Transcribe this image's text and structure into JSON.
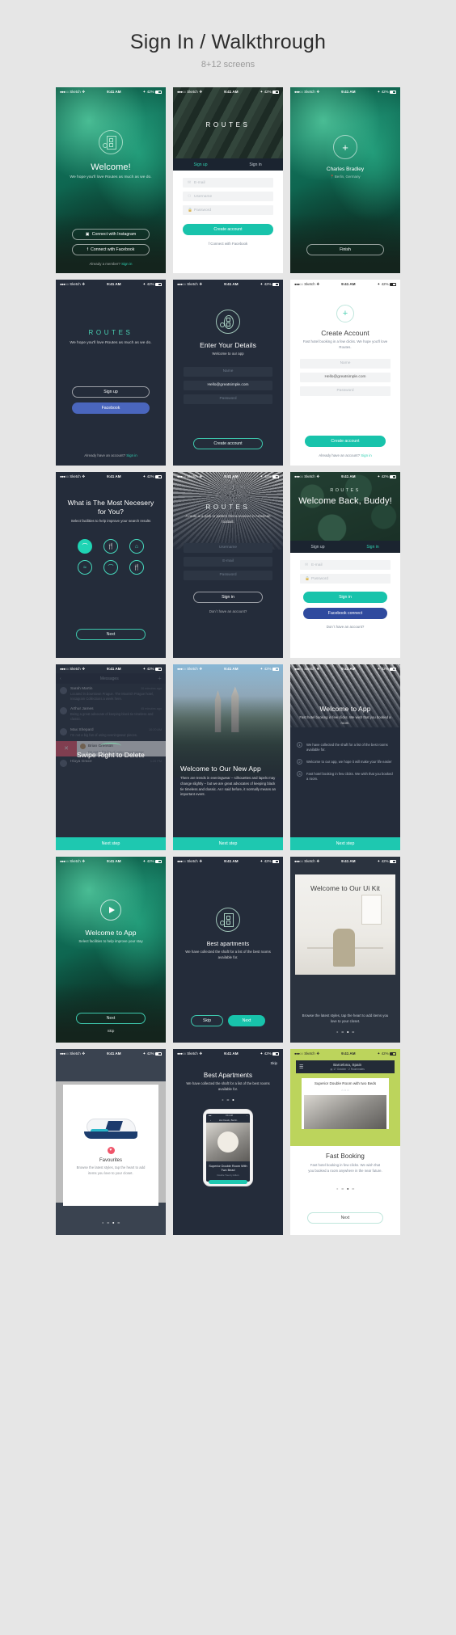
{
  "page": {
    "title": "Sign In / Walkthrough",
    "subtitle": "8+12 screens"
  },
  "status": {
    "carrier": "Sketch",
    "time": "9:41 AM",
    "battery": "42%"
  },
  "colors": {
    "teal": "#18c3ab",
    "facebook": "#4a66bd",
    "accent_link": "#2fd0b2",
    "red": "#f0556a",
    "lime": "#bcd45c"
  },
  "brand": "ROUTES",
  "screens": [
    {
      "id": "welcome-aurora",
      "title": "Welcome!",
      "desc": "We hope you'll love Routes as much as we do.",
      "btn_instagram": "Connect with Instagram",
      "btn_facebook": "Connect with Facebook",
      "footer": "Already a member?",
      "footer_link": "Sign in"
    },
    {
      "id": "routes-signup-form",
      "brand": "ROUTES",
      "tab_signup": "Sign up",
      "tab_signin": "Sign in",
      "field_email": "E-mail",
      "field_username": "Username",
      "field_password": "Password",
      "btn_create": "Create account",
      "footer_fb": "Connect with Facebook"
    },
    {
      "id": "profile-finish",
      "name": "Charles Bradley",
      "location": "Berlin, Germany",
      "btn_finish": "Finish"
    },
    {
      "id": "routes-dark-signup",
      "brand": "ROUTES",
      "desc": "We hope you'll love Routes as much as we do.",
      "btn_signup": "Sign up",
      "btn_facebook": "Facebook",
      "footer": "Already have an account?",
      "footer_link": "Sign in"
    },
    {
      "id": "enter-your-details",
      "title": "Enter Your Details",
      "desc": "Welcome to our app",
      "field_name": "Name",
      "field_email": "Hello@greatsimple.com",
      "field_password": "Password",
      "btn_create": "Create account"
    },
    {
      "id": "create-account-white",
      "title": "Create Account",
      "desc": "Fast hotel booking in a few clicks. We hope you'll love Routes.",
      "field_name": "Name",
      "field_email": "Hello@greatsimple.com",
      "field_password": "Password",
      "btn_create": "Create account",
      "footer": "Already have an account?",
      "footer_link": "Sign in"
    },
    {
      "id": "facilities",
      "title": "What is The Most Necesery for You?",
      "desc": "Select facilities to help improve your search results",
      "btn_next": "Next",
      "icons": [
        "wifi",
        "restaurant",
        "room-service",
        "spa",
        "wifi",
        "restaurant"
      ]
    },
    {
      "id": "routes-signin-dark",
      "brand": "ROUTES",
      "desc": "A route is a path or pattern that a receiver in American football.",
      "field_username": "Username",
      "field_email": "E-mail",
      "field_password": "Password",
      "btn_signin": "Sign in",
      "footer": "Don`t have an account?"
    },
    {
      "id": "welcome-back",
      "brand": "ROUTES",
      "title": "Welcome Back, Buddy!",
      "tab_signup": "Sign up",
      "tab_signin": "Sign in",
      "field_email": "E-mail",
      "field_password": "Password",
      "btn_signin": "Sign in",
      "btn_facebook": "Facebook connect",
      "footer": "Don`t have an account?"
    },
    {
      "id": "swipe-to-delete",
      "nav_title": "Messages",
      "overlay_title": "Swipe Right to Delete",
      "btn_next_step": "Next step",
      "messages": [
        {
          "name": "Sarah Martin",
          "time": "10 minutes ago",
          "text": "Located in downtown Prague. The Moorish Prague hotel, Instagram Collections a week here."
        },
        {
          "name": "Arthur James",
          "time": "45 minutes ago",
          "text": "Being a great advocate of keeping black tie timeless and classic."
        },
        {
          "name": "Max Shepard",
          "time": "10:20 AM",
          "text": "I'm not a big fan of using eveningwear pieces."
        },
        {
          "name": "Brian Grenson",
          "time": "",
          "text": "I'm not a big fan of using eveningwear"
        },
        {
          "name": "Hiuya Grace",
          "time": "1:20 PM",
          "text": ""
        }
      ]
    },
    {
      "id": "welcome-new-app",
      "title": "Welcome to Our New App",
      "desc": "There are trends in eveningwear – silhouettes and lapels may change slightly – but we are great advocates of keeping black tie timeless and classic. As I said before, it normally means an important event.",
      "btn_next_step": "Next step"
    },
    {
      "id": "welcome-to-app-list",
      "title": "Welcome to App",
      "desc": "Fast hotel booking in few clicks. We wish that you booked a room.",
      "items": [
        {
          "n": "1",
          "text": "We have collected the shaft for a list of the best rooms available for."
        },
        {
          "n": "2",
          "text": "Welcome to our app, we hope it will make your life easier"
        },
        {
          "n": "3",
          "text": "Fast hotel booking in few clicks. We wish that you booked a room."
        }
      ],
      "btn_next_step": "Next step"
    },
    {
      "id": "welcome-to-app-video",
      "title": "Welcome to App",
      "desc": "Select facilities to help improve your stay",
      "btn_next": "Next",
      "btn_skip": "Skip"
    },
    {
      "id": "best-apartments-dark",
      "title": "Best apartments",
      "desc": "We have collected the shaft for a list of the best rooms available for.",
      "btn_skip": "Skip",
      "btn_next": "Next"
    },
    {
      "id": "welcome-ui-kit",
      "title": "Welcome to Our Ui Kit",
      "desc": "Browse the latest styles, tap the heart to add items you love to your closet.",
      "page_index": 3,
      "page_count": 4
    },
    {
      "id": "favourites",
      "title": "Favourites",
      "desc": "Browse the latest styles, tap the heart to add items you love to your closet.",
      "page_index": 3,
      "page_count": 4
    },
    {
      "id": "best-apartments-phone",
      "title": "Best Apartments",
      "desc": "We have collected the shaft for a list of the best rooms available for.",
      "btn_skip": "Skip",
      "page_index": 3,
      "page_count": 3,
      "phone": {
        "nav_title": "Hot Deals, Berlin",
        "room_title": "Superior Double Room With Two Bead",
        "room_sub": "Double Tree by Hilton"
      }
    },
    {
      "id": "fast-booking",
      "title": "Fast Booking",
      "desc": "Fast hotel booking in few clicks. We wish that you booked a room anywhere in the near future.",
      "btn_next": "Next",
      "page_index": 3,
      "page_count": 4,
      "card": {
        "city": "Barcelona, Spain",
        "dates": "17 October",
        "guests": "2 Roommates",
        "room_title": "Superior Double Room with two Beds"
      }
    }
  ]
}
